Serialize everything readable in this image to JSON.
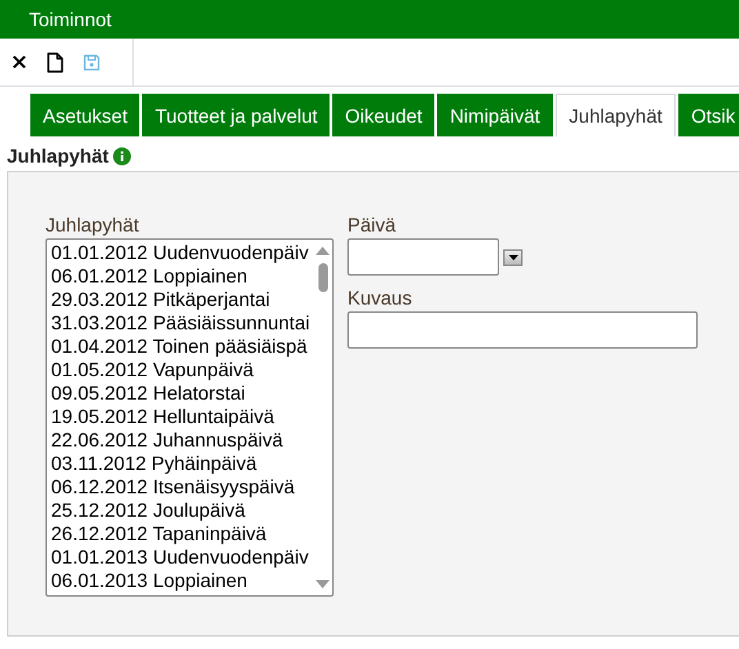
{
  "window": {
    "title": "Toiminnot"
  },
  "toolbar": [
    {
      "kind": "close",
      "disabled": false
    },
    {
      "kind": "new",
      "disabled": false
    },
    {
      "kind": "save",
      "disabled": true
    }
  ],
  "tabs": [
    {
      "label": "Asetukset",
      "selected": false
    },
    {
      "label": "Tuotteet ja palvelut",
      "selected": false
    },
    {
      "label": "Oikeudet",
      "selected": false
    },
    {
      "label": "Nimipäivät",
      "selected": false
    },
    {
      "label": "Juhlapyhät",
      "selected": true
    },
    {
      "label": "Otsik",
      "selected": false
    }
  ],
  "section": {
    "title": "Juhlapyhät"
  },
  "list": {
    "label": "Juhlapyhät",
    "items": [
      "01.01.2012 Uudenvuodenpäiv",
      "06.01.2012 Loppiainen",
      "29.03.2012 Pitkäperjantai",
      "31.03.2012 Pääsiäissunnuntai",
      "01.04.2012 Toinen pääsiäispä",
      "01.05.2012 Vapunpäivä",
      "09.05.2012 Helatorstai",
      "19.05.2012 Helluntaipäivä",
      "22.06.2012 Juhannuspäivä",
      "03.11.2012 Pyhäinpäivä",
      "06.12.2012 Itsenäisyyspäivä",
      "25.12.2012 Joulupäivä",
      "26.12.2012 Tapaninpäivä",
      "01.01.2013 Uudenvuodenpäiv",
      "06.01.2013 Loppiainen"
    ]
  },
  "date_field": {
    "label": "Päivä"
  },
  "description_field": {
    "label": "Kuvaus"
  }
}
